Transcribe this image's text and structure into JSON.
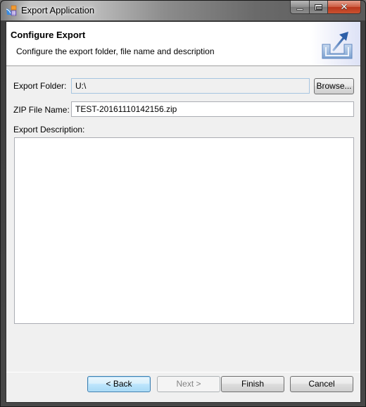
{
  "window": {
    "title": "Export Application",
    "app_icon": "export-application-icon",
    "controls": {
      "minimize_icon": "minimize-icon",
      "maximize_icon": "maximize-icon",
      "close_icon": "close-icon",
      "close_glyph": "✕"
    }
  },
  "banner": {
    "title": "Configure Export",
    "description": "Configure the export folder, file name and description",
    "image_icon": "export-tray-icon"
  },
  "form": {
    "export_folder": {
      "label": "Export Folder:",
      "value": "U:\\"
    },
    "browse_button": "Browse...",
    "zip_file_name": {
      "label": "ZIP File Name:",
      "value": "TEST-20161110142156.zip"
    },
    "export_description": {
      "label": "Export Description:",
      "value": ""
    }
  },
  "buttons": {
    "back": "< Back",
    "next": "Next >",
    "finish": "Finish",
    "cancel": "Cancel"
  },
  "colors": {
    "close_red": "#c9522f",
    "focus_blue": "#3c7fb1",
    "dialog_bg": "#f0f0f0"
  }
}
